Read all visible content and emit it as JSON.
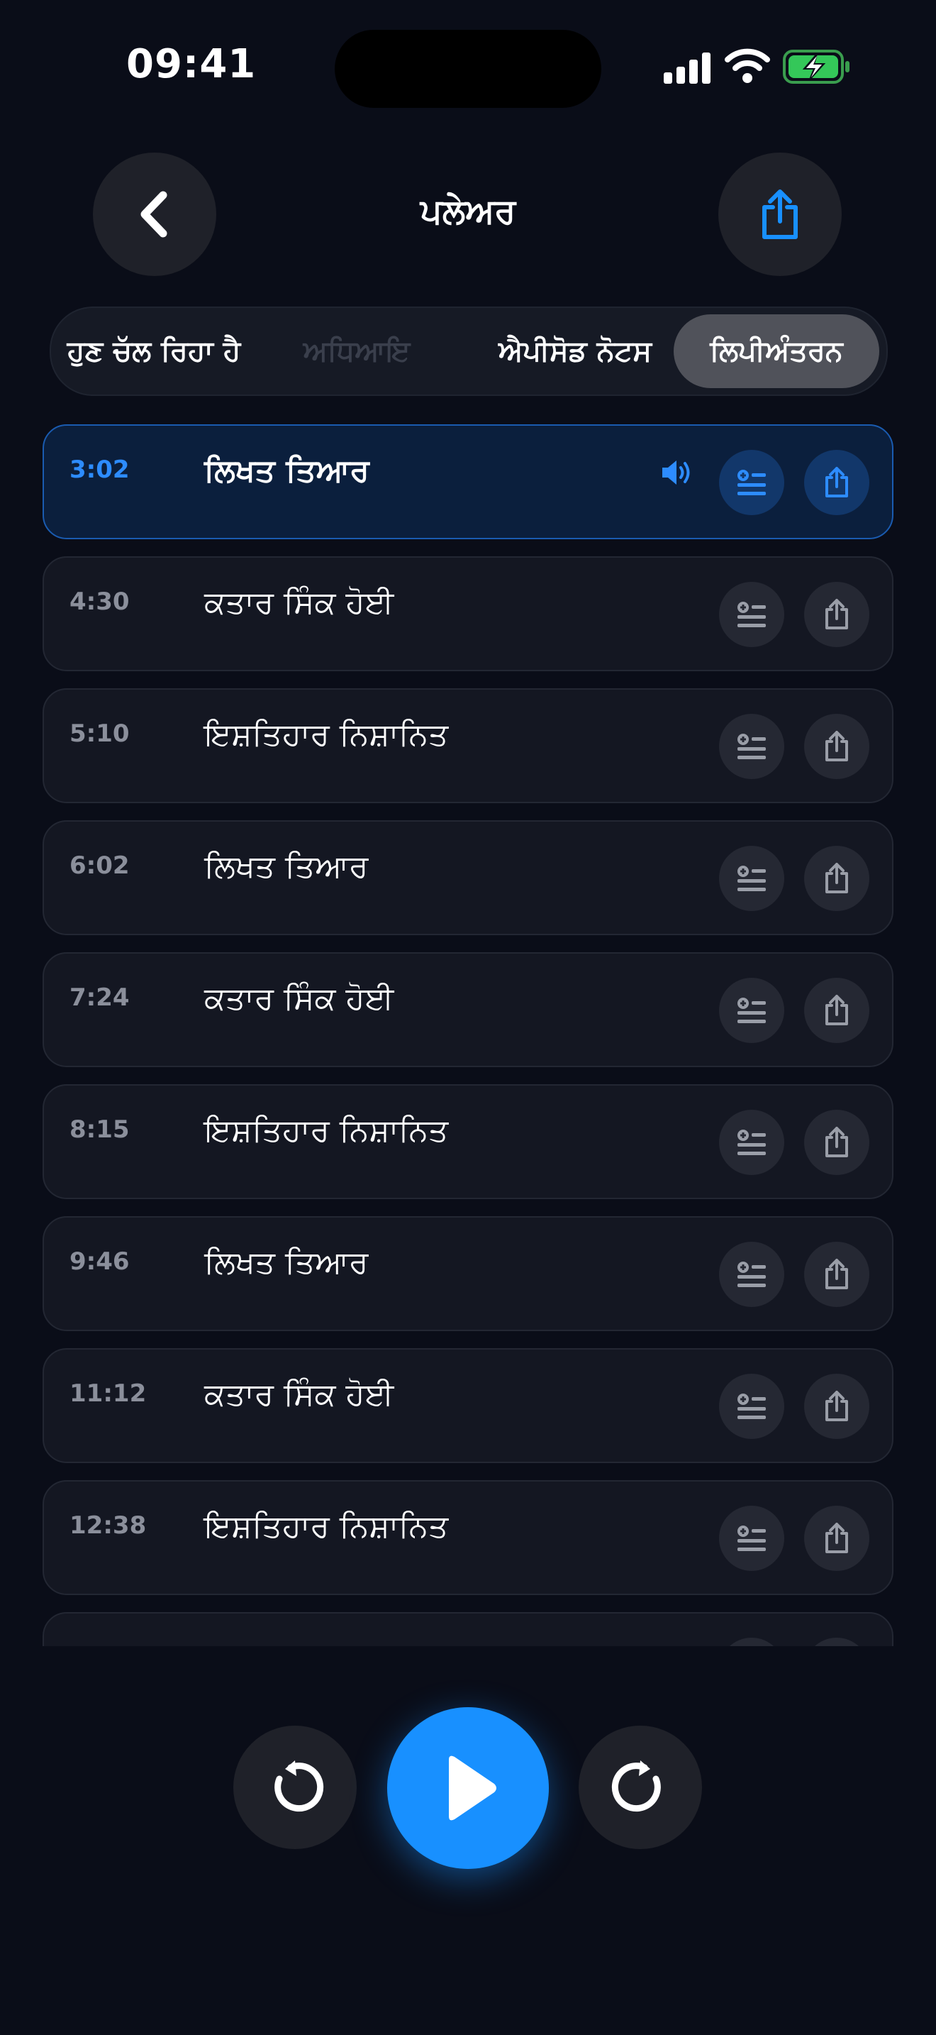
{
  "status_bar": {
    "time": "09:41"
  },
  "header": {
    "title": "ਪਲੇਅਰ",
    "back_icon": "chevron-left-icon",
    "share_icon": "share-icon",
    "accent": "#1890ff"
  },
  "tabs": [
    {
      "label": "ਹੁਣ ਚੱਲ ਰਿਹਾ ਹੈ",
      "state": "normal"
    },
    {
      "label": "ਅਧਿਆਇ",
      "state": "disabled"
    },
    {
      "label": "ਐਪੀਸੋਡ ਨੋਟਸ",
      "state": "normal"
    },
    {
      "label": "ਲਿਪੀਅੰਤਰਨ",
      "state": "selected"
    }
  ],
  "transcript": [
    {
      "time": "3:02",
      "text": "ਲਿਖਤ ਤਿਆਰ",
      "active": true
    },
    {
      "time": "4:30",
      "text": "ਕਤਾਰ ਸਿੰਕ ਹੋਈ",
      "active": false
    },
    {
      "time": "5:10",
      "text": "ਇਸ਼ਤਿਹਾਰ ਨਿਸ਼ਾਨਿਤ",
      "active": false
    },
    {
      "time": "6:02",
      "text": "ਲਿਖਤ ਤਿਆਰ",
      "active": false
    },
    {
      "time": "7:24",
      "text": "ਕਤਾਰ ਸਿੰਕ ਹੋਈ",
      "active": false
    },
    {
      "time": "8:15",
      "text": "ਇਸ਼ਤਿਹਾਰ ਨਿਸ਼ਾਨਿਤ",
      "active": false
    },
    {
      "time": "9:46",
      "text": "ਲਿਖਤ ਤਿਆਰ",
      "active": false
    },
    {
      "time": "11:12",
      "text": "ਕਤਾਰ ਸਿੰਕ ਹੋਈ",
      "active": false
    },
    {
      "time": "12:38",
      "text": "ਇਸ਼ਤਿਹਾਰ ਨਿਸ਼ਾਨਿਤ",
      "active": false
    }
  ],
  "controls": {
    "rewind_icon": "rewind-icon",
    "play_icon": "play-icon",
    "forward_icon": "forward-icon"
  }
}
